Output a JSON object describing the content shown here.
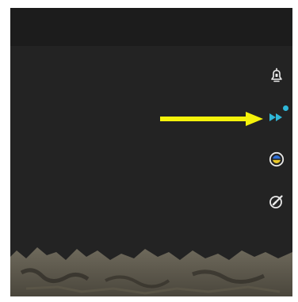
{
  "toolbar": {
    "items": [
      {
        "icon": "lock-pin-icon",
        "active": false
      },
      {
        "icon": "fast-forward-icon",
        "active": true,
        "badge": true
      },
      {
        "icon": "color-filter-icon",
        "active": false
      },
      {
        "icon": "edit-compass-icon",
        "active": false
      }
    ]
  },
  "colors": {
    "background": "#232323",
    "topbar": "#1c1c1c",
    "icon": "#e9e9e9",
    "accent": "#2fb7d8",
    "annotation_arrow": "#f5f20a"
  }
}
